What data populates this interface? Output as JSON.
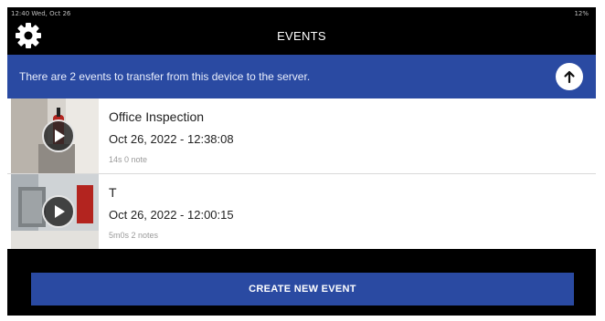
{
  "status_bar": {
    "left": "12:40 Wed, Oct 26",
    "right": "12%"
  },
  "header": {
    "title": "EVENTS",
    "settings_icon": "gear-icon"
  },
  "banner": {
    "message": "There are 2 events to transfer from this device to the server.",
    "upload_icon": "arrow-up-icon"
  },
  "events": [
    {
      "title": "Office Inspection",
      "date": "Oct 26, 2022 - 12:38:08",
      "meta": "14s 0 note"
    },
    {
      "title": "T",
      "date": "Oct 26, 2022 - 12:00:15",
      "meta": "5m0s 2 notes"
    }
  ],
  "footer": {
    "create_label": "CREATE NEW EVENT"
  },
  "colors": {
    "accent": "#2a4aa2",
    "background": "#000000"
  }
}
